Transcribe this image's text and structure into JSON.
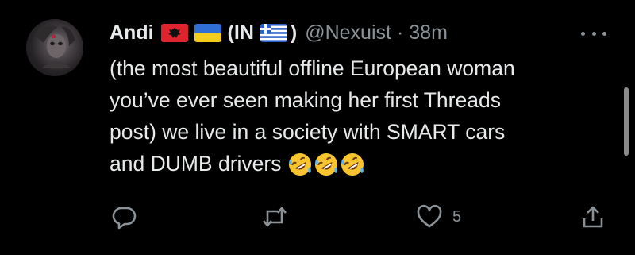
{
  "author": {
    "name": "Andi",
    "paren_open": "(IN",
    "paren_close": ")",
    "handle": "@Nexuist",
    "separator": "·",
    "time": "38m",
    "flags": [
      "albania-flag-icon",
      "ukraine-flag-icon",
      "greece-flag-icon"
    ]
  },
  "post": {
    "lines": [
      "(the most beautiful offline European woman",
      "you’ve ever seen making her first Threads",
      "post) we live in a society with SMART cars",
      "and DUMB drivers"
    ],
    "emojis": [
      "rolling-on-floor-laughing-emoji",
      "rolling-on-floor-laughing-emoji",
      "rolling-on-floor-laughing-emoji"
    ]
  },
  "actions": {
    "like_count": "5",
    "icons": [
      "reply-icon",
      "retweet-icon",
      "like-icon",
      "share-icon"
    ]
  },
  "colors": {
    "background": "#000000",
    "text": "#e7e9ea",
    "muted": "#8b9298"
  }
}
